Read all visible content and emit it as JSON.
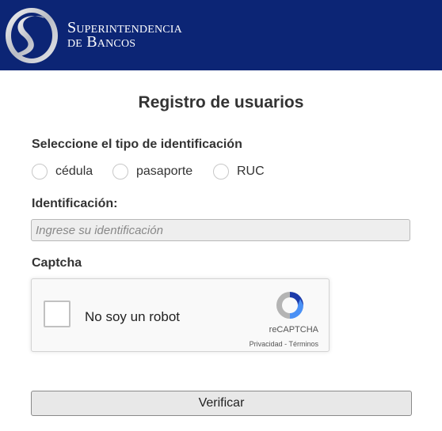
{
  "header": {
    "logo_icon": "superintendencia-s-logo",
    "logo_line1": "Superintendencia",
    "logo_line2": "de Bancos",
    "background_color": "#0c2575"
  },
  "form": {
    "title": "Registro de usuarios",
    "id_type_label": "Seleccione el tipo de identificación",
    "id_types": [
      {
        "label": "cédula",
        "selected": false
      },
      {
        "label": "pasaporte",
        "selected": false
      },
      {
        "label": "RUC",
        "selected": false
      }
    ],
    "identification_label": "Identificación:",
    "identification_value": "",
    "identification_placeholder": "Ingrese su identificación",
    "captcha_label": "Captcha",
    "verify_label": "Verificar"
  },
  "recaptcha": {
    "checkbox_checked": false,
    "checkbox_label": "No soy un robot",
    "brand": "reCAPTCHA",
    "privacy_link": "Privacidad",
    "separator": " - ",
    "terms_link": "Términos",
    "icon": "recaptcha-icon"
  }
}
